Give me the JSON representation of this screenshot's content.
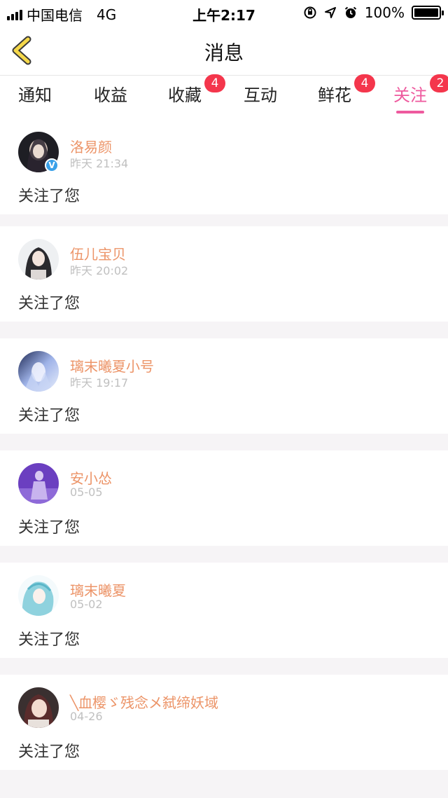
{
  "status": {
    "carrier": "中国电信",
    "network": "4G",
    "time": "上午2:17",
    "battery": "100%",
    "battery_level": 1.0
  },
  "nav": {
    "title": "消息"
  },
  "tabs": [
    {
      "label": "通知",
      "badge": ""
    },
    {
      "label": "收益",
      "badge": ""
    },
    {
      "label": "收藏",
      "badge": "4"
    },
    {
      "label": "互动",
      "badge": ""
    },
    {
      "label": "鲜花",
      "badge": "4"
    },
    {
      "label": "关注",
      "badge": "2"
    }
  ],
  "active_tab": "关注",
  "colors": {
    "accent": "#ee5a9e",
    "badge": "#f4364c",
    "name": "#ec9468"
  },
  "items": [
    {
      "name": "洛易颜",
      "time": "昨天 21:34",
      "message": "关注了您",
      "verified": true
    },
    {
      "name": "伍儿宝贝",
      "time": "昨天 20:02",
      "message": "关注了您",
      "verified": false
    },
    {
      "name": "璃末曦夏小号",
      "time": "昨天 19:17",
      "message": "关注了您",
      "verified": false
    },
    {
      "name": "安小怂",
      "time": "05-05",
      "message": "关注了您",
      "verified": false
    },
    {
      "name": "璃末曦夏",
      "time": "05-02",
      "message": "关注了您",
      "verified": false
    },
    {
      "name": "╲血樱ゞ残念メ弑缔妖域",
      "time": "04-26",
      "message": "关注了您",
      "verified": false
    }
  ]
}
